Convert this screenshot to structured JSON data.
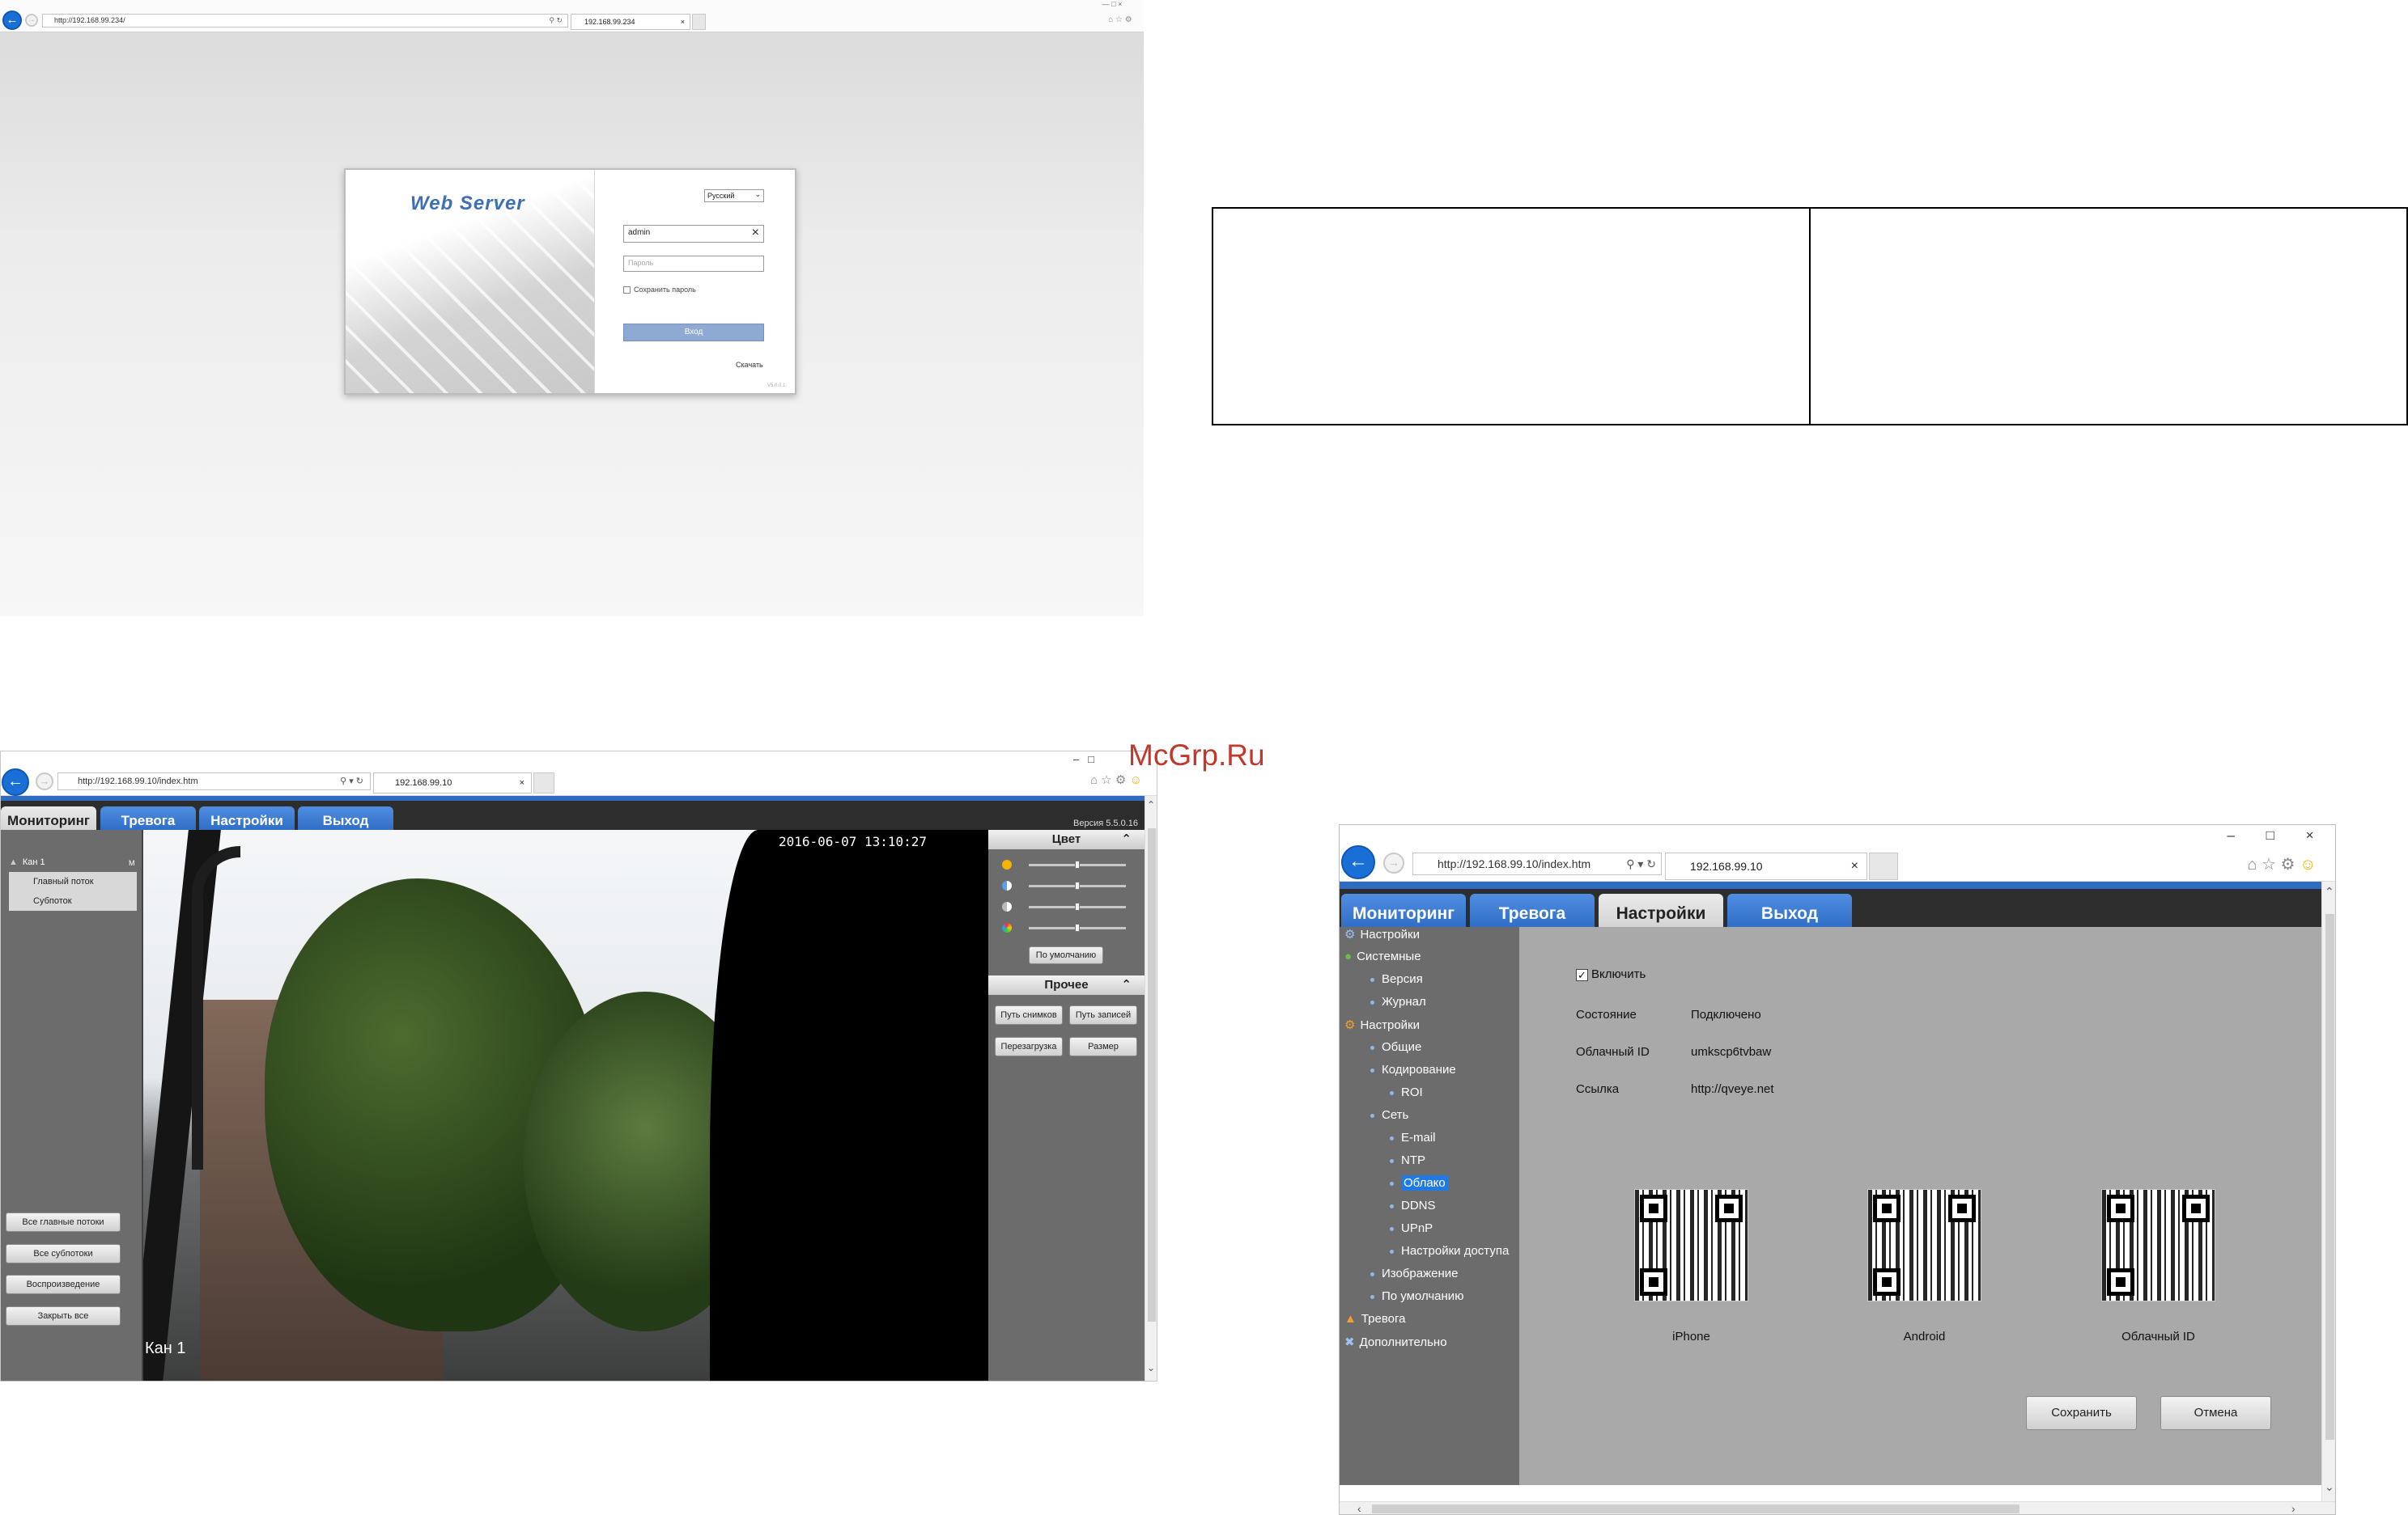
{
  "login_window": {
    "url": "http://192.168.99.234/",
    "tab_title": "192.168.99.234",
    "logo_text": "Web Server",
    "language": "Русский",
    "username_value": "admin",
    "password_placeholder": "Пароль",
    "remember_label": "Сохранить пароль",
    "login_button": "Вход",
    "download_link": "Скачать",
    "version": "V5.0.0.1"
  },
  "monitor_window": {
    "url": "http://192.168.99.10/index.htm",
    "tab_title": "192.168.99.10",
    "nav_tabs": [
      "Мониторинг",
      "Тревога",
      "Настройки",
      "Выход"
    ],
    "version_label": "Версия 5.5.0.16",
    "channel": {
      "name": "Кан 1",
      "badge": "M",
      "streams": [
        "Главный поток",
        "Субпоток"
      ]
    },
    "left_buttons": [
      "Все главные потоки",
      "Все субпотоки",
      "Воспроизведение",
      "Закрыть все"
    ],
    "video": {
      "timestamp": "2016-06-07  13:10:27",
      "channel_label": "Кан 1"
    },
    "color_section": {
      "title": "Цвет",
      "sliders": [
        {
          "icon": "brightness-icon",
          "value": 0.5
        },
        {
          "icon": "contrast-icon",
          "value": 0.5
        },
        {
          "icon": "saturation-icon",
          "value": 0.5
        },
        {
          "icon": "hue-icon",
          "value": 0.5
        }
      ],
      "default_button": "По умолчанию"
    },
    "other_section": {
      "title": "Прочее",
      "buttons": [
        "Путь снимков",
        "Путь записей",
        "Перезагрузка",
        "Размер"
      ]
    }
  },
  "watermark": "McGrp.Ru",
  "cloud_window": {
    "url": "http://192.168.99.10/index.htm",
    "tab_title": "192.168.99.10",
    "nav_tabs": [
      "Мониторинг",
      "Тревога",
      "Настройки",
      "Выход"
    ],
    "tree": {
      "root": "Настройки",
      "system": "Системные",
      "system_items": [
        "Версия",
        "Журнал"
      ],
      "settings": "Настройки",
      "settings_items": [
        "Общие",
        "Кодирование"
      ],
      "encoding_items": [
        "ROI"
      ],
      "network": "Сеть",
      "network_items": [
        "E-mail",
        "NTP",
        "Облако",
        "DDNS",
        "UPnP",
        "Настройки доступа"
      ],
      "more_items": [
        "Изображение",
        "По умолчанию"
      ],
      "alarm": "Тревога",
      "advanced": "Дополнительно"
    },
    "form": {
      "enable_label": "Включить",
      "enabled": true,
      "status_label": "Состояние",
      "status_value": "Подключено",
      "cloud_id_label": "Облачный ID",
      "cloud_id_value": "umkscp6tvbaw",
      "link_label": "Ссылка",
      "link_value": "http://qveye.net",
      "qr_captions": [
        "iPhone",
        "Android",
        "Облачный ID"
      ],
      "save_button": "Сохранить",
      "cancel_button": "Отмена"
    }
  }
}
